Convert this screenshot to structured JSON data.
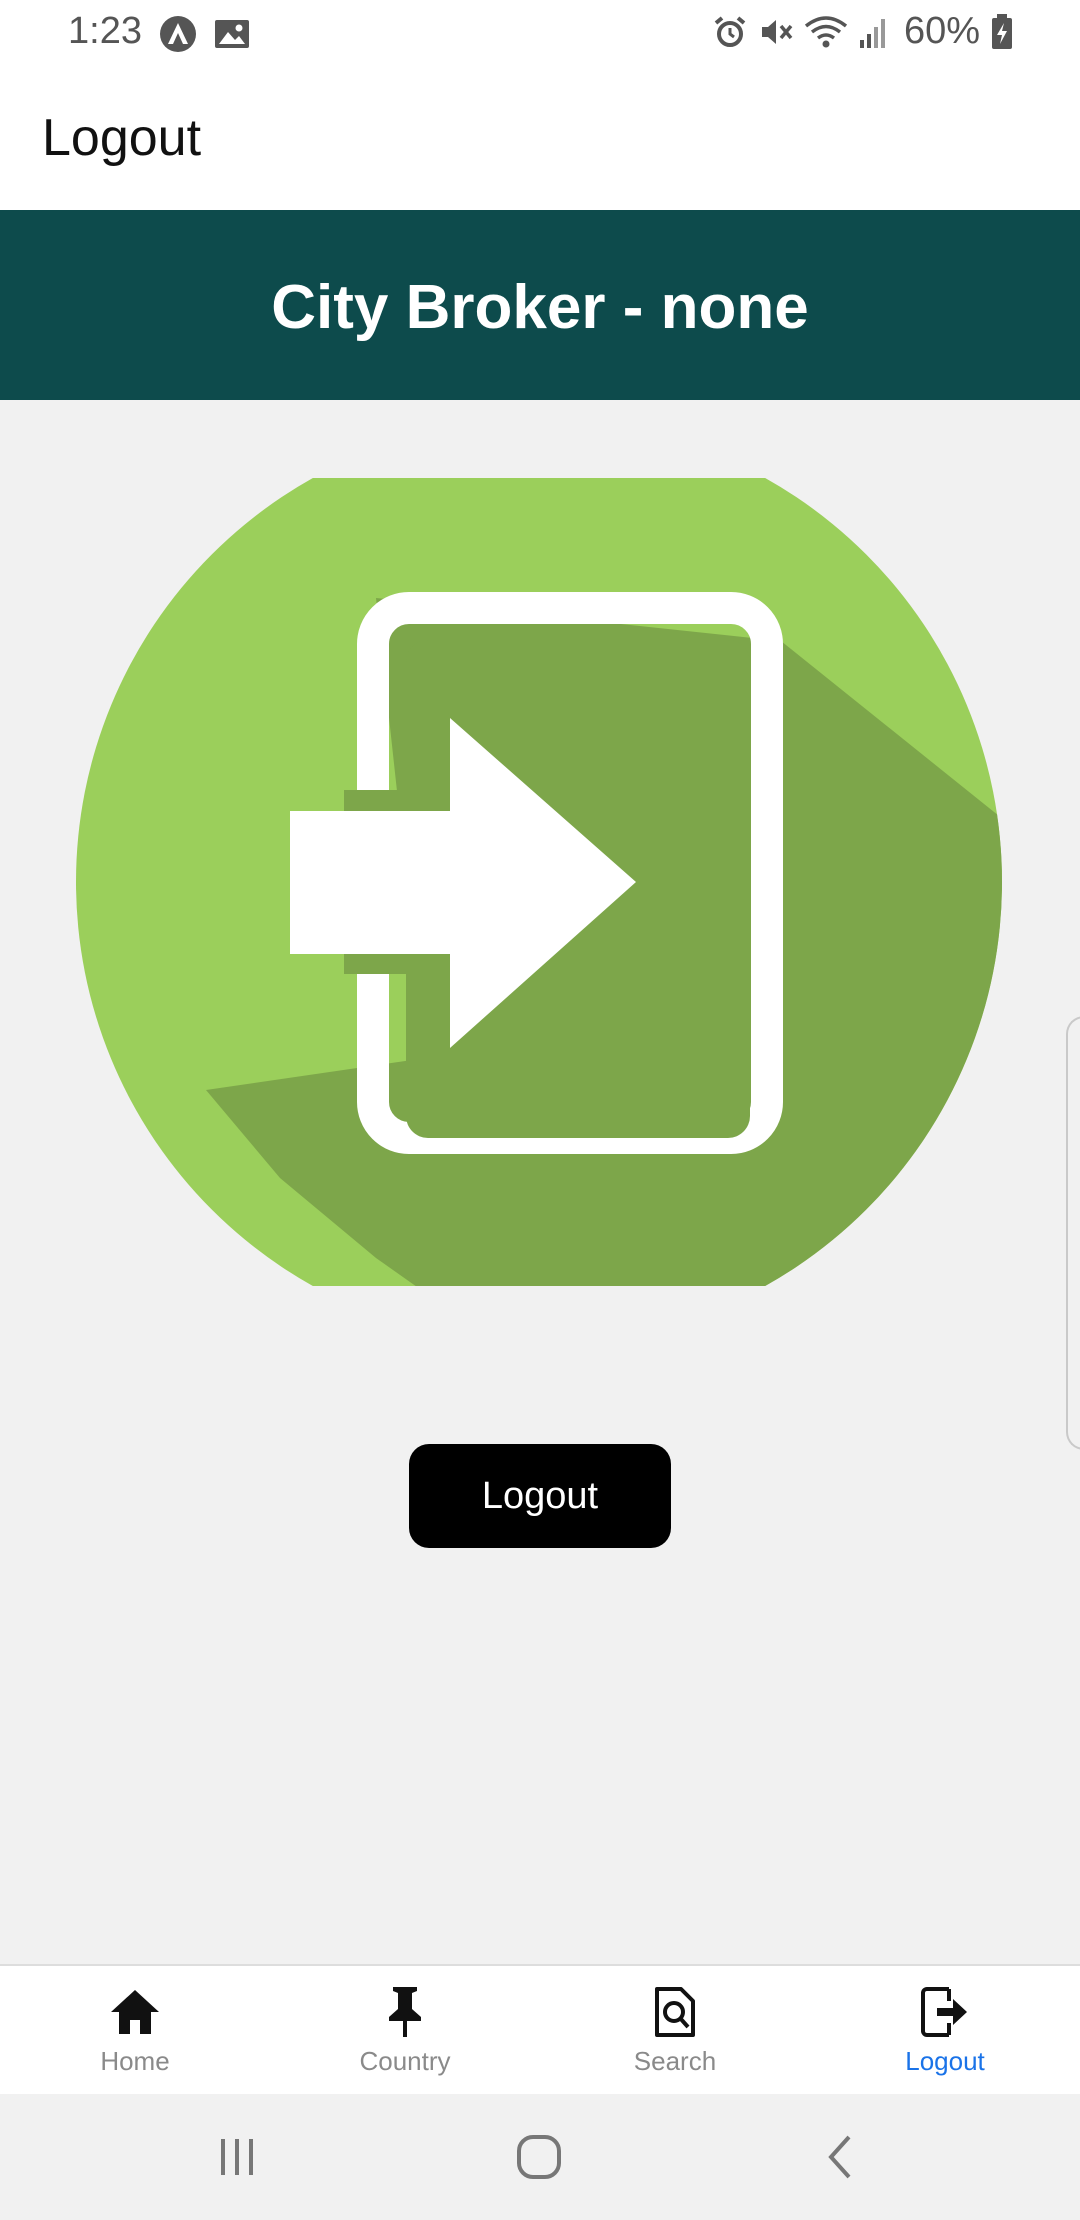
{
  "status_bar": {
    "time": "1:23",
    "battery": "60%",
    "icons": [
      "app-notification-icon",
      "image-notification-icon",
      "alarm-icon",
      "mute-icon",
      "wifi-icon",
      "signal-icon",
      "battery-icon"
    ]
  },
  "header": {
    "title": "Logout"
  },
  "banner": {
    "title": "City Broker - none",
    "background": "#0d4b4c"
  },
  "hero": {
    "icon": "logout-illustration-icon",
    "circle_color": "#9bcf5b",
    "shadow_color": "#7da64a"
  },
  "main": {
    "logout_button": "Logout"
  },
  "tabs": [
    {
      "label": "Home",
      "icon": "home-icon",
      "active": false
    },
    {
      "label": "Country",
      "icon": "pushpin-icon",
      "active": false
    },
    {
      "label": "Search",
      "icon": "search-document-icon",
      "active": false
    },
    {
      "label": "Logout",
      "icon": "logout-icon",
      "active": true
    }
  ],
  "colors": {
    "active_tab": "#1a73e8",
    "inactive_tab": "#8a8a8a"
  },
  "nav_bar": {
    "icons": [
      "recent-apps-icon",
      "home-circle-icon",
      "back-icon"
    ]
  }
}
